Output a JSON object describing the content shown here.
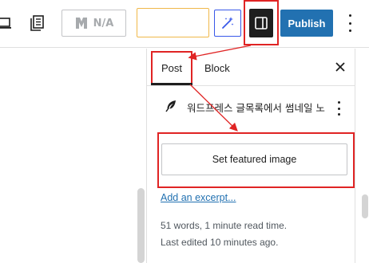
{
  "toolbar": {
    "seo_badge_label": "N/A",
    "publish_label": "Publish"
  },
  "sidebar": {
    "tabs": [
      {
        "label": "Post"
      },
      {
        "label": "Block"
      }
    ],
    "post_title": "워드프레스 글목록에서 썸네일 노",
    "featured_image_label": "Set featured image",
    "excerpt_link": "Add an excerpt...",
    "word_count": "51 words, 1 minute read time.",
    "last_edited": "Last edited 10 minutes ago."
  },
  "colors": {
    "accent_blue": "#2271b1",
    "ai_blue": "#3858e9",
    "annotation_red": "#e02424",
    "field_orange": "#f0b849"
  },
  "icons": [
    "preview-icon",
    "document-list-icon",
    "seo-logo-icon",
    "magic-wand-icon",
    "sidebar-panel-icon",
    "more-options-icon",
    "close-icon",
    "feather-icon"
  ]
}
